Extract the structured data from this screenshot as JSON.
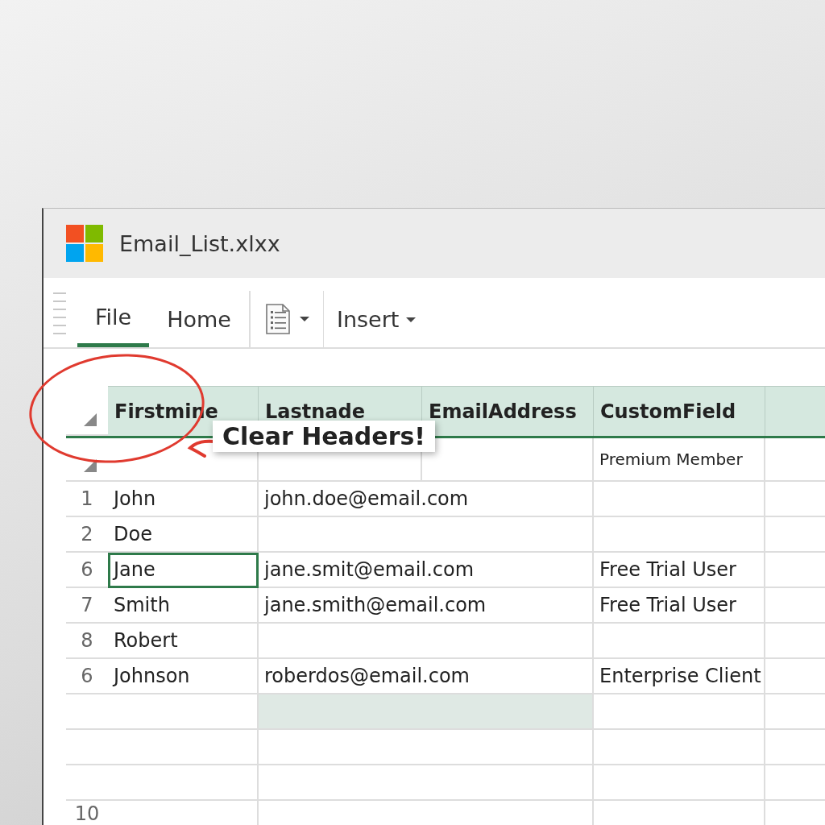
{
  "window": {
    "title": "Email_List.xlxx"
  },
  "tabs": [
    {
      "label": "File",
      "selected": true
    },
    {
      "label": "Home",
      "selected": false
    }
  ],
  "menus": [
    {
      "kind": "icon"
    },
    {
      "kind": "text",
      "label": "Insert"
    }
  ],
  "table": {
    "columns": [
      "Firstmine",
      "Lastnade",
      "EmailAddress",
      "CustomField"
    ],
    "subheader": {
      "custom": "Premium Member"
    },
    "rows": [
      {
        "num": "1",
        "first": "John",
        "email": "john.doe@email.com",
        "custom": "",
        "selected": false,
        "highlighted": false
      },
      {
        "num": "2",
        "first": "Doe",
        "email": "",
        "custom": "",
        "selected": false,
        "highlighted": false
      },
      {
        "num": "6",
        "first": "Jane",
        "email": "jane.smit@email.com",
        "custom": "Free Trial User",
        "selected": true,
        "highlighted": false
      },
      {
        "num": "7",
        "first": "Smith",
        "email": "jane.smith@email.com",
        "custom": "Free Trial User",
        "selected": false,
        "highlighted": false
      },
      {
        "num": "8",
        "first": "Robert",
        "email": "",
        "custom": "",
        "selected": false,
        "highlighted": false
      },
      {
        "num": "6",
        "first": "Johnson",
        "email": "roberdos@email.com",
        "custom": "Enterprise Client",
        "selected": false,
        "highlighted": false
      },
      {
        "num": "",
        "first": "",
        "email": "",
        "custom": "",
        "selected": false,
        "highlighted": true
      },
      {
        "num": "",
        "first": "",
        "email": "",
        "custom": "",
        "selected": false,
        "highlighted": false
      },
      {
        "num": "",
        "first": "",
        "email": "",
        "custom": "",
        "selected": false,
        "highlighted": false
      },
      {
        "num": "10",
        "first": "",
        "email": "",
        "custom": "",
        "selected": false,
        "highlighted": false
      }
    ]
  },
  "callout": {
    "text": "Clear Headers!"
  }
}
